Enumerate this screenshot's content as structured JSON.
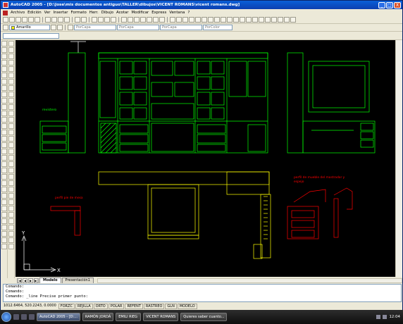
{
  "window": {
    "title": "AutoCAD 2005 - [D:\\Jose\\mis documentos antiguo\\TALLER\\dibujos\\VICENT ROMANS\\vicent romans.dwg]",
    "minimize": "_",
    "maximize": "□",
    "close": "X"
  },
  "menu": [
    "Archivo",
    "Edición",
    "Ver",
    "Insertar",
    "Formato",
    "Herr.",
    "Dibujo",
    "Acotar",
    "Modificar",
    "Express",
    "Ventana",
    "?"
  ],
  "toolbar": {
    "layer_value": "Amarillo",
    "linetype1": "PorCapa",
    "linetype2": "PorCapa",
    "lineweight": "PorCapa",
    "plotstyle": "PorColor"
  },
  "drawing": {
    "labels": {
      "revistero": "revistero",
      "perfil_pie": "perfil pie de mesa",
      "perfil_mueble_1": "perfil de mueble del mostrador y",
      "perfil_mueble_2": "espejo",
      "ucs_x": "X",
      "ucs_y": "Y"
    }
  },
  "tabs": {
    "model": "Modelo",
    "layout1": "Presentación1",
    "nav_first": "|◀",
    "nav_prev": "◀",
    "nav_next": "▶",
    "nav_last": "▶|"
  },
  "command": {
    "line1": "Comando:",
    "line2": "Comando:",
    "line3": "Comando: _line Precise primer punto:"
  },
  "status": {
    "coords": "1012.6464, 520.2243, 0.0000",
    "toggles": [
      "FORZC",
      "REJILLA",
      "ORTO",
      "POLAR",
      "REFENT",
      "RASTREO",
      "GLN",
      "MODELO"
    ]
  },
  "taskbar": {
    "tasks": [
      "AutoCAD 2005 - [D:...",
      "RAMÓN JORDÁ",
      "EMILI RIEG",
      "VICENT ROMANS",
      "Quieres saber cuanto..."
    ],
    "clock": "12:04"
  },
  "colors": {
    "drawing_bg": "#000000",
    "green": "#00ff00",
    "yellow": "#ffff00",
    "red": "#ff0000",
    "white": "#ffffff"
  }
}
